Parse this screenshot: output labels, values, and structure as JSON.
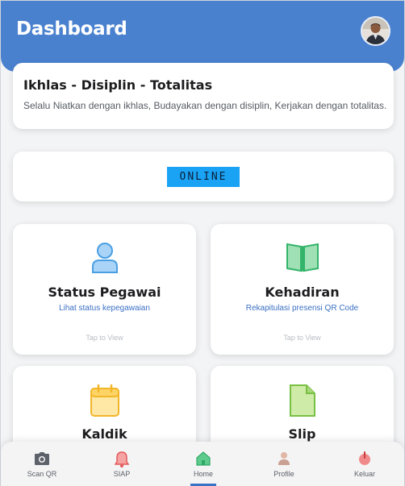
{
  "header": {
    "title": "Dashboard"
  },
  "motto": {
    "title": "Ikhlas - Disiplin - Totalitas",
    "subtitle": "Selalu Niatkan dengan ikhlas, Budayakan dengan disiplin, Kerjakan dengan totalitas."
  },
  "status": {
    "label": "ONLINE",
    "color": "#1aa3f4"
  },
  "tiles": [
    {
      "title": "Status Pegawai",
      "subtitle": "Lihat status kepegawaian",
      "tap": "Tap to View",
      "icon": "person-icon"
    },
    {
      "title": "Kehadiran",
      "subtitle": "Rekapitulasi presensi QR Code",
      "tap": "Tap to View",
      "icon": "book-icon"
    },
    {
      "title": "Kaldik",
      "subtitle": "",
      "tap": "",
      "icon": "calendar-icon"
    },
    {
      "title": "Slip",
      "subtitle": "",
      "tap": "",
      "icon": "document-icon"
    }
  ],
  "nav": {
    "items": [
      {
        "label": "Scan QR",
        "icon": "camera-icon"
      },
      {
        "label": "SIAP",
        "icon": "bell-icon"
      },
      {
        "label": "Home",
        "icon": "home-icon"
      },
      {
        "label": "Profile",
        "icon": "user-icon"
      },
      {
        "label": "Keluar",
        "icon": "power-icon"
      }
    ],
    "active": "Home"
  },
  "colors": {
    "primary": "#4a81cf",
    "link": "#3a6fc4"
  }
}
